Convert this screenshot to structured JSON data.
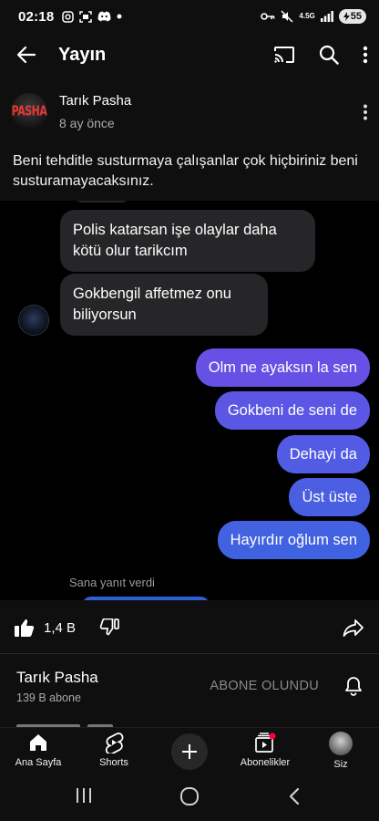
{
  "status_bar": {
    "time": "02:18",
    "network": "4.5G",
    "battery": "55",
    "icons": [
      "instagram-icon",
      "screenshot-icon",
      "discord-icon",
      "dot-icon",
      "key-icon",
      "mute-icon",
      "signal-icon"
    ]
  },
  "app_bar": {
    "title": "Yayın",
    "icons": [
      "back-arrow-icon",
      "cast-icon",
      "search-icon",
      "more-vert-icon"
    ]
  },
  "post": {
    "author": "Tarık Pasha",
    "avatar_logo_text": "PASHA",
    "time": "8 ay önce",
    "text": "Beni tehditle susturmaya çalışanlar çok hiçbiriniz beni susturamayacaksınız."
  },
  "chat": {
    "incoming": [
      "Polis katarsan işe olaylar daha kötü olur tarikcım",
      "Gokbengil affetmez onu biliyorsun"
    ],
    "outgoing": [
      "Olm ne ayaksın la sen",
      "Gokbeni de seni de",
      "Dehayi da",
      "Üst üste",
      "Hayırdır oğlum sen"
    ],
    "reply_note": "Sana yanıt verdi",
    "colors": {
      "incoming_bubble": "#262628",
      "outgoing_top": "#6a4fe6",
      "outgoing_bottom": "#3e63e0"
    }
  },
  "actions": {
    "like_count": "1,4 B",
    "icons": [
      "like-icon",
      "dislike-icon",
      "share-icon"
    ]
  },
  "channel": {
    "name": "Tarık Pasha",
    "subscribers": "139 B abone",
    "subscribe_label": "ABONE OLUNDU"
  },
  "bottom_nav": {
    "items": [
      {
        "label": "Ana Sayfa",
        "icon": "home-icon"
      },
      {
        "label": "Shorts",
        "icon": "shorts-icon"
      },
      {
        "label": "",
        "icon": "create-icon"
      },
      {
        "label": "Abonelikler",
        "icon": "subscriptions-icon"
      },
      {
        "label": "Siz",
        "icon": "avatar"
      }
    ]
  },
  "system_nav": {
    "icons": [
      "recents-icon",
      "home-circle-icon",
      "back-chevron-icon"
    ]
  }
}
